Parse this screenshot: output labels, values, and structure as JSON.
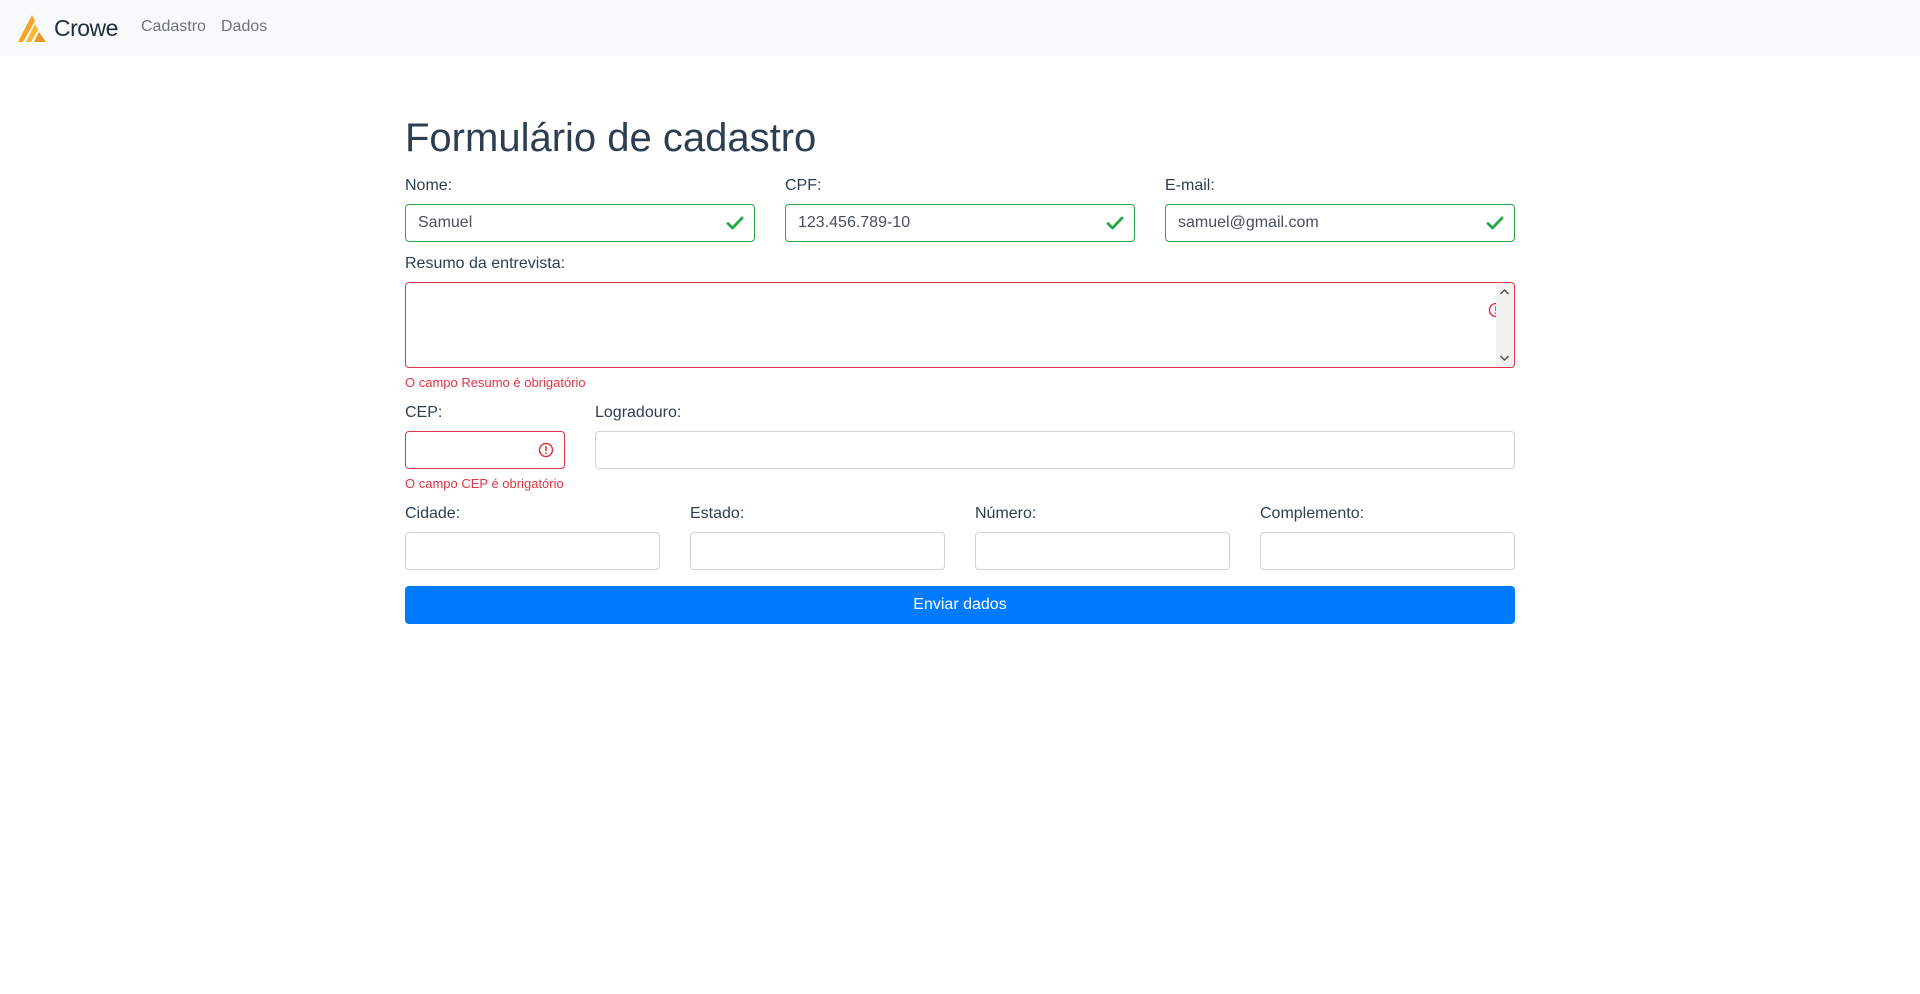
{
  "navbar": {
    "brand": "Crowe",
    "links": [
      {
        "label": "Cadastro"
      },
      {
        "label": "Dados"
      }
    ]
  },
  "form": {
    "title": "Formulário de cadastro",
    "nome": {
      "label": "Nome:",
      "value": "Samuel",
      "state": "valid"
    },
    "cpf": {
      "label": "CPF:",
      "value": "123.456.789-10",
      "state": "valid"
    },
    "email": {
      "label": "E-mail:",
      "value": "samuel@gmail.com",
      "state": "valid"
    },
    "resumo": {
      "label": "Resumo da entrevista:",
      "value": "",
      "state": "invalid",
      "error": "O campo Resumo é obrigatório"
    },
    "cep": {
      "label": "CEP:",
      "value": "",
      "state": "invalid",
      "error": "O campo CEP é obrigatório"
    },
    "logradouro": {
      "label": "Logradouro:",
      "value": ""
    },
    "cidade": {
      "label": "Cidade:",
      "value": ""
    },
    "estado": {
      "label": "Estado:",
      "value": ""
    },
    "numero": {
      "label": "Número:",
      "value": ""
    },
    "complemento": {
      "label": "Complemento:",
      "value": ""
    },
    "submit_label": "Enviar dados"
  },
  "colors": {
    "valid": "#28a745",
    "invalid": "#dc3545",
    "primary": "#007bff",
    "logo": "#f5a623"
  },
  "icons": {
    "brand": "crowe-logo-icon",
    "valid": "check-icon",
    "invalid": "exclamation-circle-icon"
  }
}
